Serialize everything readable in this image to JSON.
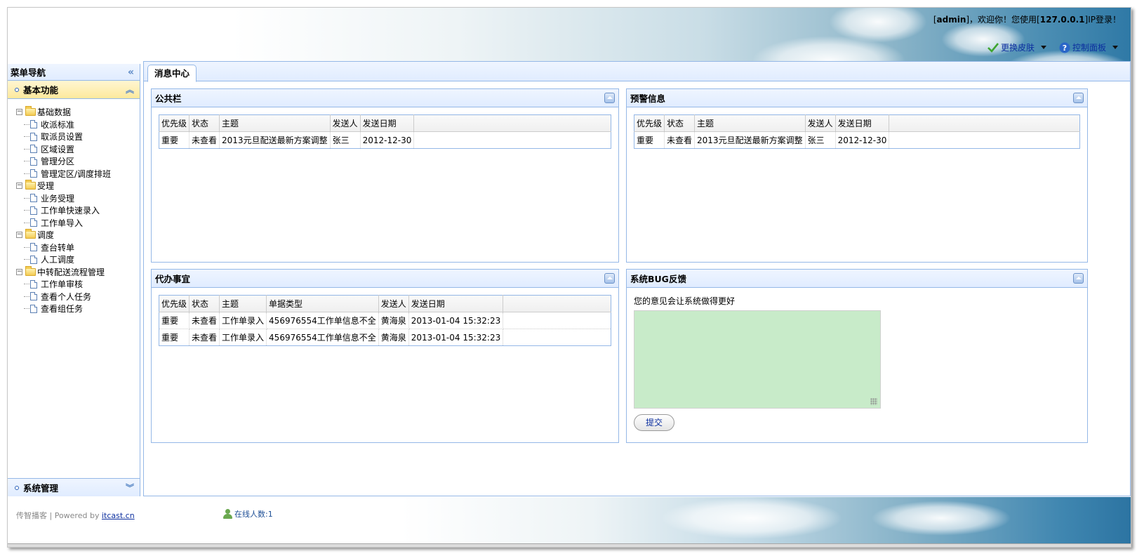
{
  "header": {
    "login_prefix": "[",
    "user": "admin",
    "login_middle": "]，欢迎你！您使用[",
    "ip": "127.0.0.1",
    "login_suffix": "]IP登录！",
    "change_skin": "更换皮肤",
    "control_panel": "控制面板"
  },
  "west": {
    "title": "菜单导航",
    "accordion": [
      {
        "label": "基本功能"
      },
      {
        "label": "系统管理"
      }
    ],
    "tree": [
      {
        "label": "基础数据",
        "children": [
          "收派标准",
          "取派员设置",
          "区域设置",
          "管理分区",
          "管理定区/调度排班"
        ]
      },
      {
        "label": "受理",
        "children": [
          "业务受理",
          "工作单快速录入",
          "工作单导入"
        ]
      },
      {
        "label": "调度",
        "children": [
          "查台转单",
          "人工调度"
        ]
      },
      {
        "label": "中转配送流程管理",
        "children": [
          "工作单审核",
          "查看个人任务",
          "查看组任务"
        ]
      }
    ]
  },
  "center": {
    "tab": "消息中心",
    "notice": {
      "title": "公共栏",
      "headers": [
        "优先级",
        "状态",
        "主题",
        "发送人",
        "发送日期"
      ],
      "rows": [
        [
          "重要",
          "未查看",
          "2013元旦配送最新方案调整",
          "张三",
          "2012-12-30"
        ]
      ]
    },
    "alert": {
      "title": "预警信息",
      "headers": [
        "优先级",
        "状态",
        "主题",
        "发送人",
        "发送日期"
      ],
      "rows": [
        [
          "重要",
          "未查看",
          "2013元旦配送最新方案调整",
          "张三",
          "2012-12-30"
        ]
      ]
    },
    "todo": {
      "title": "代办事宜",
      "headers": [
        "优先级",
        "状态",
        "主题",
        "单据类型",
        "发送人",
        "发送日期"
      ],
      "rows": [
        [
          "重要",
          "未查看",
          "工作单录入",
          "456976554工作单信息不全",
          "黄海泉",
          "2013-01-04 15:32:23"
        ],
        [
          "重要",
          "未查看",
          "工作单录入",
          "456976554工作单信息不全",
          "黄海泉",
          "2013-01-04 15:32:23"
        ]
      ]
    },
    "bug": {
      "title": "系统BUG反馈",
      "prompt": "您的意见会让系统做得更好",
      "submit": "提交"
    }
  },
  "footer": {
    "powered_prefix": "传智播客 | Powered by ",
    "powered_link": "itcast.cn",
    "online": "在线人数:1"
  }
}
